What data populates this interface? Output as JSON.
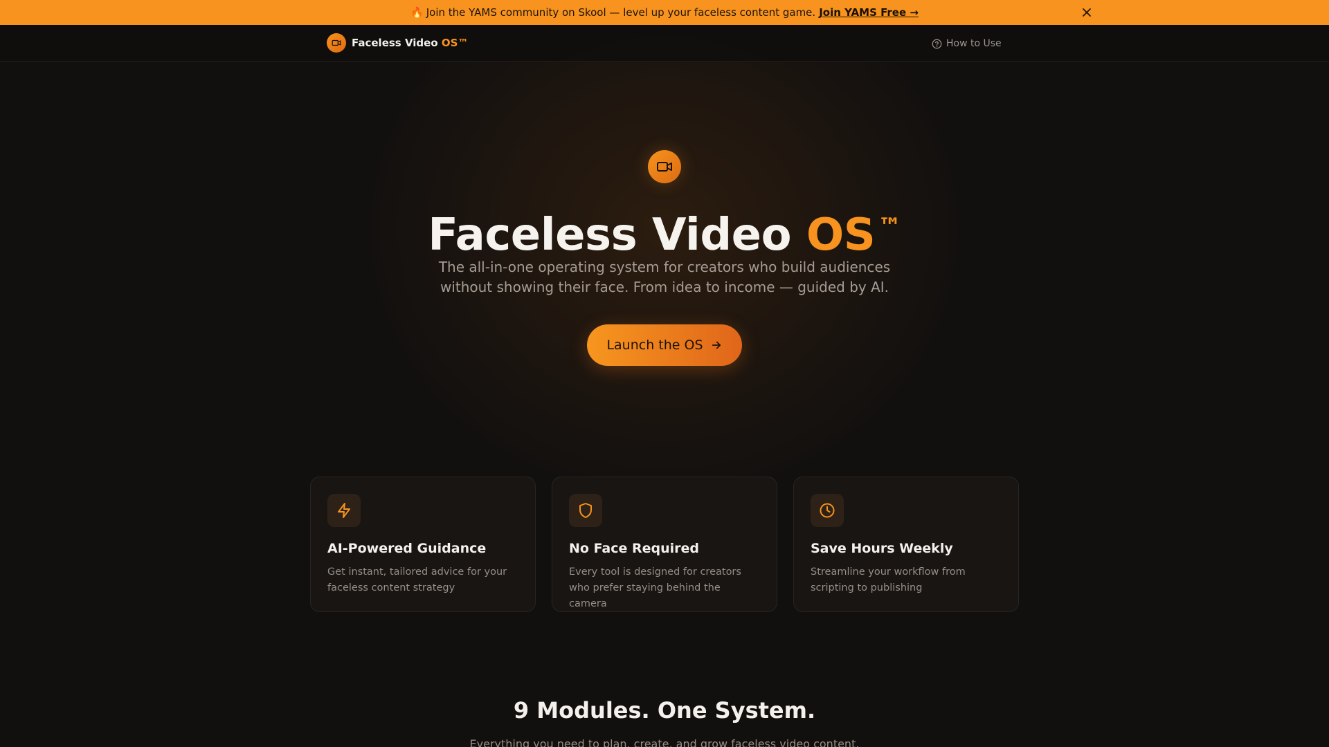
{
  "promo": {
    "emoji": "🔥",
    "text": "Join the YAMS community on Skool — level up your faceless content game.",
    "link": "Join YAMS Free →"
  },
  "nav": {
    "brand_main": "Faceless Video ",
    "brand_accent": "OS™",
    "how_to_use": "How to Use"
  },
  "hero": {
    "title_main": "Faceless Video ",
    "title_accent": "OS",
    "title_tm": "™",
    "subtitle": "The all-in-one operating system for creators who build audiences without showing their face. From idea to income — guided by AI.",
    "cta": "Launch the OS"
  },
  "features": [
    {
      "icon": "lightning-icon",
      "title": "AI-Powered Guidance",
      "desc": "Get instant, tailored advice for your faceless content strategy"
    },
    {
      "icon": "shield-icon",
      "title": "No Face Required",
      "desc": "Every tool is designed for creators who prefer staying behind the camera"
    },
    {
      "icon": "clock-icon",
      "title": "Save Hours Weekly",
      "desc": "Streamline your workflow from scripting to publishing"
    }
  ],
  "modules": {
    "title": "9 Modules. One System.",
    "subtitle": "Everything you need to plan, create, and grow faceless video content."
  },
  "colors": {
    "accent": "#f7931e",
    "background": "#12100f",
    "banner": "#f7931e"
  }
}
